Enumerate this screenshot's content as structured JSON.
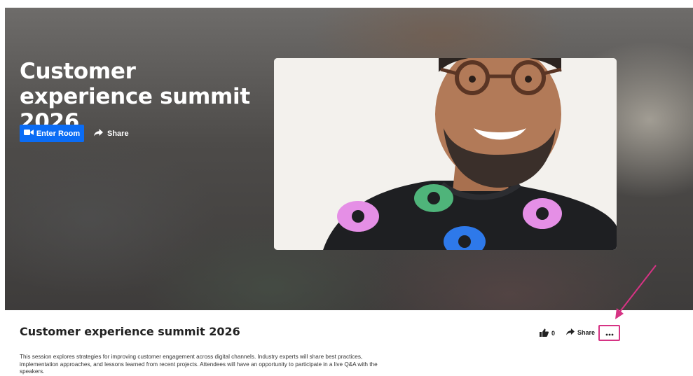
{
  "hero": {
    "title": "Customer experience summit 2026",
    "enter_room_label": "Enter Room",
    "share_label": "Share"
  },
  "details": {
    "title": "Customer experience summit 2026",
    "description": "This session explores strategies for improving customer engagement across digital channels. Industry experts will share best practices, implementation approaches, and lessons learned from recent projects. Attendees will have an opportunity to participate in a live Q&A with the speakers.",
    "like_count": "0",
    "share_label": "Share"
  },
  "colors": {
    "primary_button": "#0a6cf5",
    "annotation": "#d63384"
  },
  "icons": [
    "video-camera-icon",
    "share-arrow-icon",
    "thumbs-up-icon",
    "more-options-icon"
  ]
}
